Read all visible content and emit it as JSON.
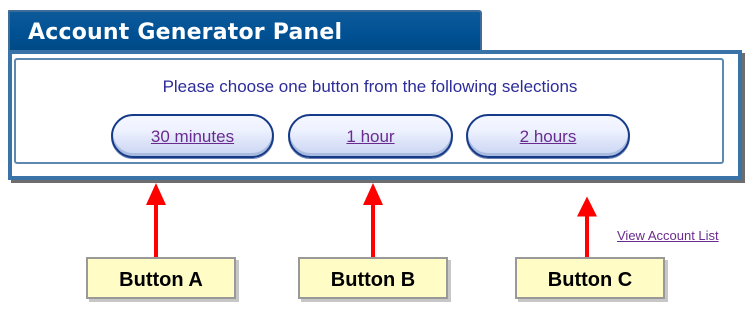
{
  "panel": {
    "title": "Account Generator Panel",
    "instruction": "Please choose one button from the following selections",
    "buttons": [
      {
        "label": "30 minutes"
      },
      {
        "label": "1 hour"
      },
      {
        "label": "2 hours"
      }
    ]
  },
  "links": {
    "view_account_list": "View Account List"
  },
  "annotations": {
    "labels": [
      {
        "text": "Button A"
      },
      {
        "text": "Button B"
      },
      {
        "text": "Button C"
      }
    ],
    "arrow_color": "#ff0000"
  },
  "colors": {
    "panel_header": "#005194",
    "panel_border": "#3a73a7",
    "instruction_text": "#2c2c9a",
    "button_text": "#6a2b8f",
    "label_background": "#fffcc6"
  }
}
